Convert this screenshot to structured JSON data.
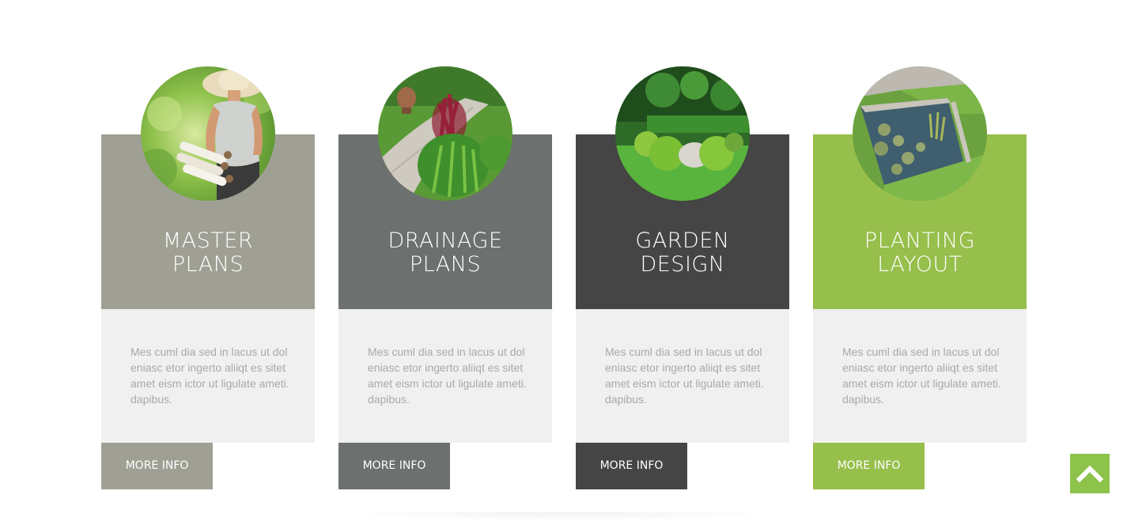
{
  "services": [
    {
      "title_line1": "MASTER",
      "title_line2": "PLANS",
      "description": "Mes cuml dia sed in lacus ut dol eniasc etor ingerto aliiqt es sitet amet eism ictor ut ligulate ameti. dapibus.",
      "button_label": "MORE INFO",
      "accent_color": "#a09f94",
      "image": "woman-with-blueprints-photo"
    },
    {
      "title_line1": "DRAINAGE",
      "title_line2": "PLANS",
      "description": "Mes cuml dia sed in lacus ut dol eniasc etor ingerto aliiqt es sitet amet eism ictor ut ligulate ameti. dapibus.",
      "button_label": "MORE INFO",
      "accent_color": "#6c706e",
      "image": "garden-path-plants-photo"
    },
    {
      "title_line1": "GARDEN",
      "title_line2": "DESIGN",
      "description": "Mes cuml dia sed in lacus ut dol eniasc etor ingerto aliiqt es sitet amet eism ictor ut ligulate ameti. dapibus.",
      "button_label": "MORE INFO",
      "accent_color": "#454545",
      "image": "topiary-shrubs-lawn-photo"
    },
    {
      "title_line1": "PLANTING",
      "title_line2": "LAYOUT",
      "description": "Mes cuml dia sed in lacus ut dol eniasc etor ingerto aliiqt es sitet amet eism ictor ut ligulate ameti. dapibus.",
      "button_label": "MORE INFO",
      "accent_color": "#96bf4b",
      "image": "lily-pond-lawn-photo"
    }
  ],
  "back_to_top": {
    "icon": "chevron-up-icon",
    "color": "#8dc34a"
  },
  "colors": {
    "body_background": "#eff0ef",
    "body_text": "#a8aaa8"
  }
}
